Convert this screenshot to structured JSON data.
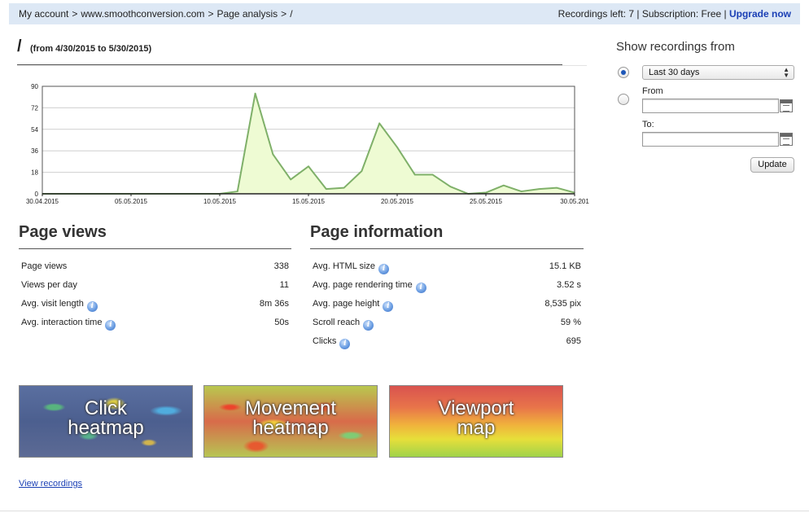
{
  "topbar": {
    "crumbs": [
      "My account",
      ">",
      "www.smoothconversion.com",
      ">",
      "Page analysis",
      ">",
      "/"
    ],
    "recordings_left": "Recordings left: 7 | Subscription: Free | ",
    "upgrade_label": "Upgrade now",
    "bg_color": "#dde8f5",
    "link_color": "#1a3fb5"
  },
  "heading": {
    "page": "/",
    "range": "(from 4/30/2015 to 5/30/2015)"
  },
  "chart_data": {
    "type": "area",
    "title": "",
    "xlabel": "",
    "ylabel": "",
    "ylim": [
      0,
      90
    ],
    "yticks": [
      "0",
      "18",
      "36",
      "54",
      "72",
      "90"
    ],
    "xtick_labels": [
      "30.04.2015",
      "05.05.2015",
      "10.05.2015",
      "15.05.2015",
      "20.05.2015",
      "25.05.2015",
      "30.05.201"
    ],
    "x": [
      "30.04",
      "01.05",
      "02.05",
      "03.05",
      "04.05",
      "05.05",
      "06.05",
      "07.05",
      "08.05",
      "09.05",
      "10.05",
      "11.05",
      "12.05",
      "13.05",
      "14.05",
      "15.05",
      "16.05",
      "17.05",
      "18.05",
      "19.05",
      "20.05",
      "21.05",
      "22.05",
      "23.05",
      "24.05",
      "25.05",
      "26.05",
      "27.05",
      "28.05",
      "29.05",
      "30.05"
    ],
    "values": [
      0,
      0,
      0,
      0,
      0,
      0,
      0,
      0,
      0,
      0,
      0,
      2,
      84,
      33,
      12,
      23,
      4,
      5,
      19,
      59,
      39,
      16,
      16,
      6,
      0,
      1,
      7,
      2,
      4,
      5,
      1
    ],
    "grid": true,
    "line_color": "#7fb069",
    "fill_color": "#eefbd3"
  },
  "page_views": {
    "title": "Page views",
    "rows": [
      {
        "label": "Page views",
        "value": "338",
        "info": false
      },
      {
        "label": "Views per day",
        "value": "11",
        "info": false
      },
      {
        "label": "Avg. visit length",
        "value": "8m 36s",
        "info": true
      },
      {
        "label": "Avg. interaction time",
        "value": "50s",
        "info": true
      }
    ]
  },
  "page_info": {
    "title": "Page information",
    "rows": [
      {
        "label": "Avg. HTML size",
        "value": "15.1 KB",
        "info": true
      },
      {
        "label": "Avg. page rendering time",
        "value": "3.52 s",
        "info": true
      },
      {
        "label": "Avg. page height",
        "value": "8,535 pix",
        "info": true
      },
      {
        "label": "Scroll reach",
        "value": "59 %",
        "info": true
      },
      {
        "label": "Clicks",
        "value": "695",
        "info": true
      }
    ]
  },
  "thumbs": {
    "click": {
      "line1": "Click",
      "line2": "heatmap"
    },
    "movement": {
      "line1": "Movement",
      "line2": "heatmap"
    },
    "viewport": {
      "line1": "Viewport",
      "line2": "map"
    }
  },
  "view_recordings": "View recordings",
  "sidebar": {
    "title": "Show recordings from",
    "select_value": "Last 30 days",
    "from_label": "From",
    "to_label": "To:",
    "from_value": "",
    "to_value": "",
    "update_label": "Update"
  }
}
